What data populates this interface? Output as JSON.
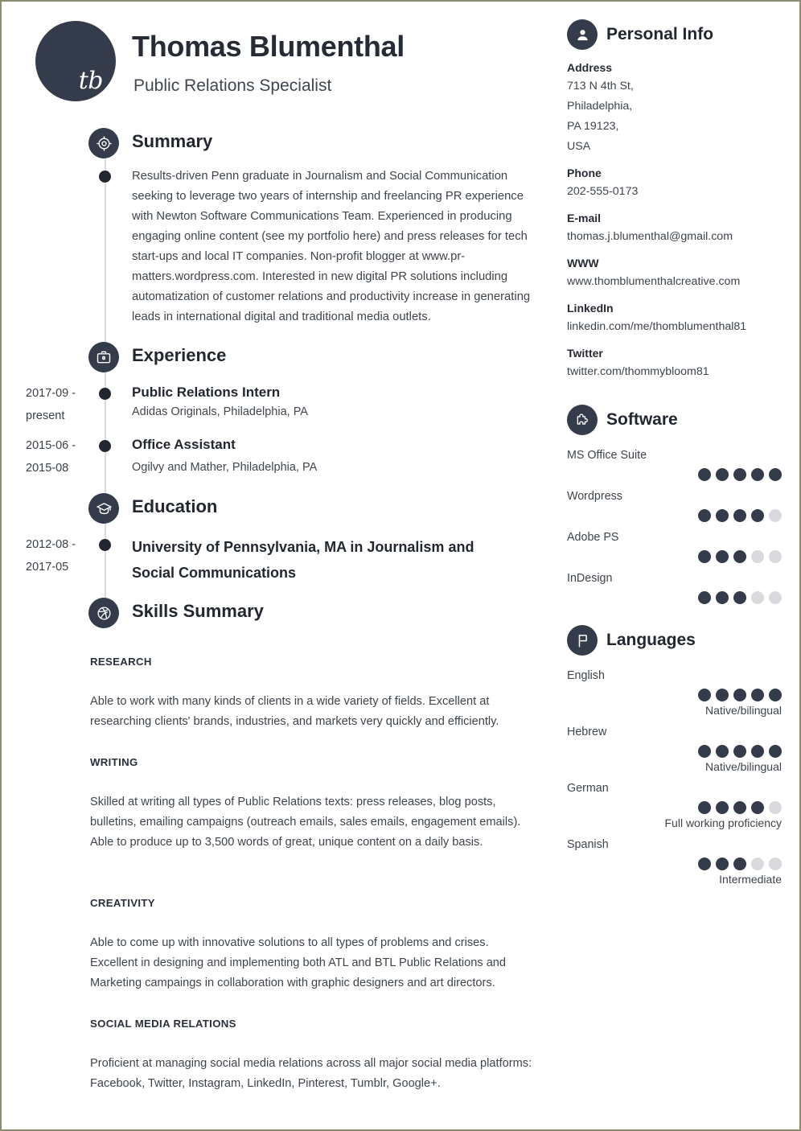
{
  "theme": {
    "dark": "#343b4a",
    "text": "#3e444c",
    "heading": "#22272f",
    "dot_off": "#d8dadd",
    "page_border": "#8d8c6e"
  },
  "header": {
    "monogram": "tb",
    "name": "Thomas Blumenthal",
    "job_title": "Public Relations Specialist"
  },
  "summary": {
    "section_title": "Summary",
    "icon": "target-icon",
    "text": "Results-driven Penn graduate in Journalism and Social Communication seeking to leverage two years of internship and freelancing PR experience with Newton Software Communications Team. Experienced in producing engaging online content (see my portfolio here) and press releases for tech start-ups and local IT companies. Non-profit blogger at www.pr-matters.wordpress.com. Interested in new digital PR solutions including automatization of customer relations and productivity increase in generating leads in international digital and traditional media outlets."
  },
  "experience": {
    "section_title": "Experience",
    "icon": "briefcase-icon",
    "items": [
      {
        "date_line1": "2017-09 -",
        "date_line2": "present",
        "title": "Public Relations Intern",
        "subtitle": "Adidas Originals, Philadelphia, PA"
      },
      {
        "date_line1": "2015-06 -",
        "date_line2": "2015-08",
        "title": "Office Assistant",
        "subtitle": "Ogilvy and Mather, Philadelphia, PA"
      }
    ]
  },
  "education": {
    "section_title": "Education",
    "icon": "graduation-cap-icon",
    "items": [
      {
        "date_line1": "2012-08 -",
        "date_line2": "2017-05",
        "title_line1": "University of Pennsylvania, MA in Journalism and",
        "title_line2": "Social Communications"
      }
    ]
  },
  "skills_summary": {
    "section_title": "Skills Summary",
    "icon": "dribbble-ball-icon",
    "blocks": [
      {
        "heading": "RESEARCH",
        "text": "Able to work with many kinds of clients in a wide variety of fields. Excellent at researching clients' brands, industries, and markets very quickly and efficiently."
      },
      {
        "heading": "WRITING",
        "text": "Skilled at writing all types of Public Relations texts: press releases, blog posts, bulletins, emailing campaigns (outreach emails, sales emails, engagement emails). Able to produce up to 3,500 words of great, unique content on a daily basis."
      },
      {
        "heading": "CREATIVITY",
        "text": "Able to come up with innovative solutions to all types of problems and crises. Excellent in designing and implementing both ATL and BTL Public Relations and Marketing campaings in collaboration with graphic designers and art directors."
      },
      {
        "heading": "SOCIAL MEDIA RELATIONS",
        "text": "Proficient at managing social media relations across all major social media platforms: Facebook, Twitter, Instagram, LinkedIn, Pinterest, Tumblr, Google+."
      }
    ]
  },
  "personal_info": {
    "section_title": "Personal Info",
    "icon": "user-avatar-icon",
    "fields": [
      {
        "label": "Address",
        "lines": [
          "713 N 4th St,",
          "Philadelphia,",
          "PA 19123,",
          "USA"
        ]
      },
      {
        "label": "Phone",
        "lines": [
          "202-555-0173"
        ]
      },
      {
        "label": "E-mail",
        "lines": [
          "thomas.j.blumenthal@gmail.com"
        ]
      },
      {
        "label": "WWW",
        "lines": [
          "www.thomblumenthalcreative.com"
        ]
      },
      {
        "label": "LinkedIn",
        "lines": [
          "linkedin.com/me/thomblumenthal81"
        ]
      },
      {
        "label": "Twitter",
        "lines": [
          "twitter.com/thommybloom81"
        ]
      }
    ]
  },
  "software": {
    "section_title": "Software",
    "icon": "puzzle-piece-icon",
    "max_rating": 5,
    "items": [
      {
        "name": "MS Office Suite",
        "rating": 5,
        "caption": ""
      },
      {
        "name": "Wordpress",
        "rating": 4,
        "caption": ""
      },
      {
        "name": "Adobe PS",
        "rating": 3,
        "caption": ""
      },
      {
        "name": "InDesign",
        "rating": 3,
        "caption": ""
      }
    ]
  },
  "languages": {
    "section_title": "Languages",
    "icon": "flag-icon",
    "max_rating": 5,
    "items": [
      {
        "name": "English",
        "rating": 5,
        "caption": "Native/bilingual"
      },
      {
        "name": "Hebrew",
        "rating": 5,
        "caption": "Native/bilingual"
      },
      {
        "name": "German",
        "rating": 4,
        "caption": "Full working proficiency"
      },
      {
        "name": "Spanish",
        "rating": 3,
        "caption": "Intermediate"
      }
    ]
  }
}
